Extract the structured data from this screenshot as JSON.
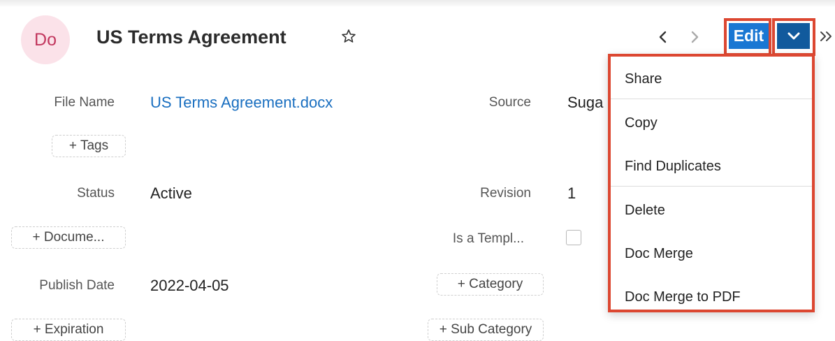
{
  "header": {
    "avatar_initials": "Do",
    "title": "US Terms Agreement",
    "edit_label": "Edit"
  },
  "fields": {
    "file_name": {
      "label": "File Name",
      "value": "US Terms Agreement.docx"
    },
    "source": {
      "label": "Source",
      "value": "Suga"
    },
    "tags_button": "+ Tags",
    "status": {
      "label": "Status",
      "value": "Active"
    },
    "revision": {
      "label": "Revision",
      "value": "1"
    },
    "document_button": "+ Docume...",
    "is_template": {
      "label": "Is a Templ...",
      "checked": false
    },
    "publish_date": {
      "label": "Publish Date",
      "value": "2022-04-05"
    },
    "category_button": "+ Category",
    "expiration_button": "+ Expiration",
    "subcategory_button": "+ Sub Category"
  },
  "actions_menu": {
    "items": [
      "Share",
      "Copy",
      "Find Duplicates",
      "Delete",
      "Doc Merge",
      "Doc Merge to PDF"
    ]
  },
  "colors": {
    "accent": "#1977d3",
    "accent_dark": "#115a9d",
    "highlight": "#dc4731",
    "link": "#1a6fc0",
    "avatar_bg": "#fbe2e9"
  },
  "icons": [
    "star-icon",
    "chevron-left-icon",
    "chevron-right-icon",
    "chevron-down-icon",
    "double-chevron-right-icon"
  ]
}
